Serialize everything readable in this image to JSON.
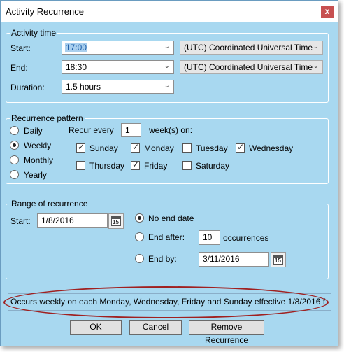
{
  "window": {
    "title": "Activity Recurrence",
    "close_label": "x"
  },
  "activity_time": {
    "group_label": "Activity time",
    "start_label": "Start:",
    "start_value": "17:00",
    "start_tz": "(UTC) Coordinated Universal Time",
    "end_label": "End:",
    "end_value": "18:30",
    "end_tz": "(UTC) Coordinated Universal Time",
    "duration_label": "Duration:",
    "duration_value": "1.5 hours"
  },
  "recurrence_pattern": {
    "group_label": "Recurrence pattern",
    "options": [
      "Daily",
      "Weekly",
      "Monthly",
      "Yearly"
    ],
    "selected": "Weekly",
    "recur_every_label": "Recur every",
    "recur_every_value": "1",
    "weeks_on_label": "week(s) on:",
    "days": [
      {
        "label": "Sunday",
        "checked": true
      },
      {
        "label": "Monday",
        "checked": true
      },
      {
        "label": "Tuesday",
        "checked": false
      },
      {
        "label": "Wednesday",
        "checked": true
      },
      {
        "label": "Thursday",
        "checked": false
      },
      {
        "label": "Friday",
        "checked": true
      },
      {
        "label": "Saturday",
        "checked": false
      }
    ]
  },
  "range": {
    "group_label": "Range of recurrence",
    "start_label": "Start:",
    "start_value": "1/8/2016",
    "no_end_label": "No end date",
    "end_after_label": "End after:",
    "end_after_value": "10",
    "occurrences_label": "occurrences",
    "end_by_label": "End by:",
    "end_by_value": "3/11/2016",
    "selected": "No end date",
    "calendar_day": "15"
  },
  "summary": "Occurs weekly on each Monday, Wednesday, Friday and Sunday effective 1/8/2016 f.",
  "buttons": {
    "ok": "OK",
    "cancel": "Cancel",
    "remove": "Remove Recurrence"
  },
  "colors": {
    "dialog_bg": "#a8d8f0",
    "highlight_ellipse": "#a02020",
    "close_button": "#c75050"
  }
}
